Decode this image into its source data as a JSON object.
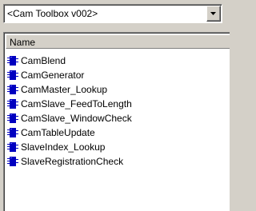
{
  "combo": {
    "selected": "<Cam Toolbox v002>"
  },
  "list": {
    "column_header": "Name",
    "items": [
      {
        "label": "CamBlend",
        "icon": "function-block-icon"
      },
      {
        "label": "CamGenerator",
        "icon": "function-block-icon"
      },
      {
        "label": "CamMaster_Lookup",
        "icon": "function-block-icon"
      },
      {
        "label": "CamSlave_FeedToLength",
        "icon": "function-block-icon"
      },
      {
        "label": "CamSlave_WindowCheck",
        "icon": "function-block-icon"
      },
      {
        "label": "CamTableUpdate",
        "icon": "function-block-icon"
      },
      {
        "label": "SlaveIndex_Lookup",
        "icon": "function-block-icon"
      },
      {
        "label": "SlaveRegistrationCheck",
        "icon": "function-block-icon"
      }
    ]
  },
  "colors": {
    "icon_blue": "#0000c0",
    "window_bg": "#d4d0c8"
  }
}
